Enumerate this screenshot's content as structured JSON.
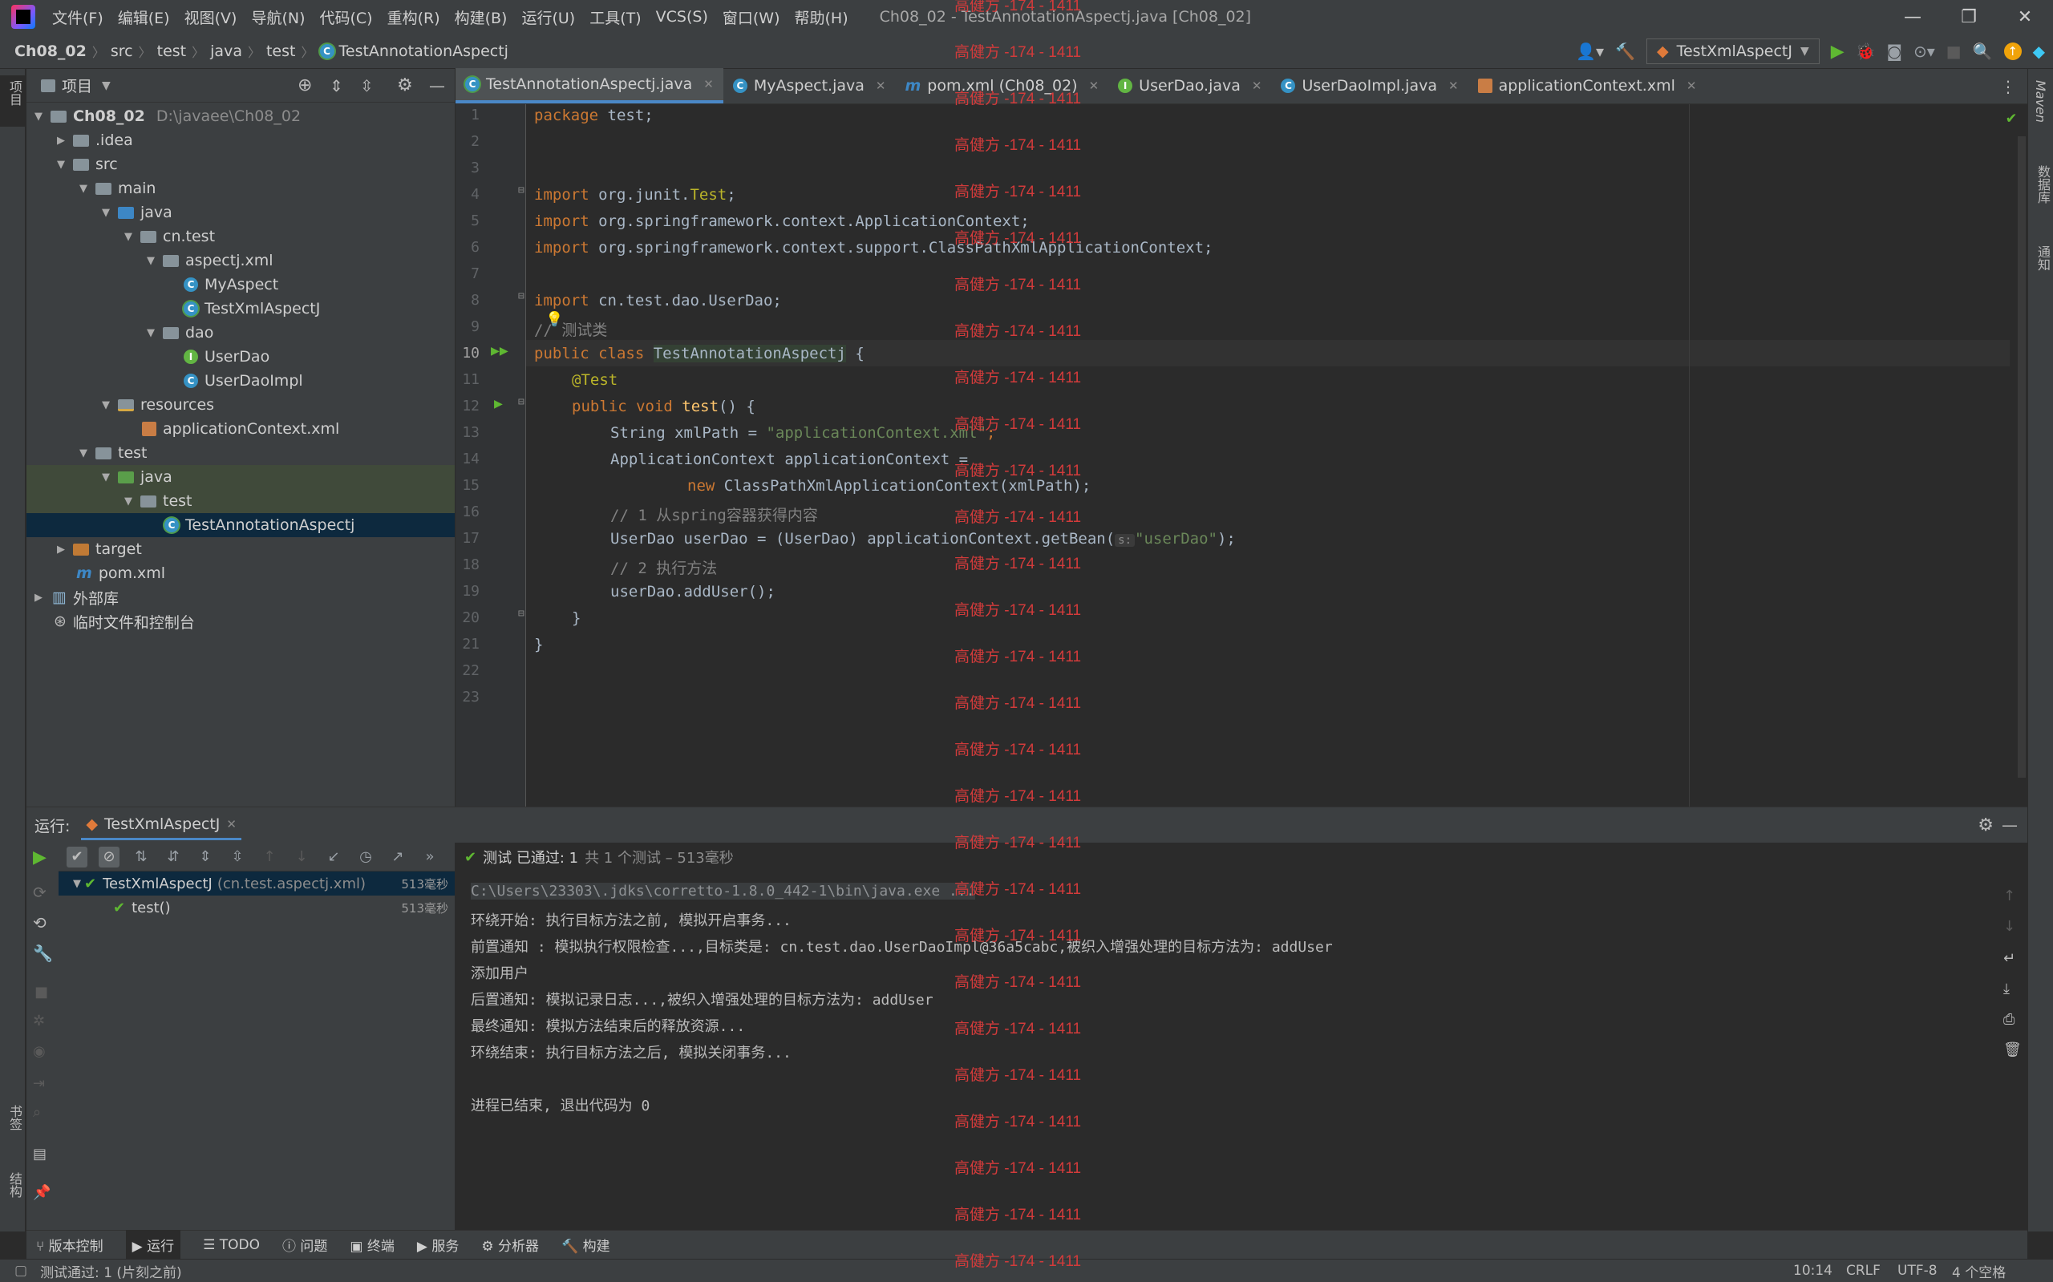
{
  "menu": {
    "items": [
      "文件(F)",
      "编辑(E)",
      "视图(V)",
      "导航(N)",
      "代码(C)",
      "重构(R)",
      "构建(B)",
      "运行(U)",
      "工具(T)",
      "VCS(S)",
      "窗口(W)",
      "帮助(H)"
    ],
    "window_title": "Ch08_02 - TestAnnotationAspectj.java [Ch08_02]"
  },
  "breadcrumb": {
    "items": [
      "Ch08_02",
      "src",
      "test",
      "java",
      "test",
      "TestAnnotationAspectj"
    ]
  },
  "toolbar": {
    "run_config": "TestXmlAspectJ"
  },
  "left_strip": {
    "project_label": "项目",
    "bookmarks_label": "书签",
    "structure_label": "结构"
  },
  "right_strip": {
    "maven_label": "Maven",
    "database_label": "数据库",
    "notifications_label": "通知"
  },
  "project": {
    "title": "项目",
    "root": {
      "name": "Ch08_02",
      "path": "D:\\javaee\\Ch08_02"
    },
    "tree": [
      ".idea",
      "src",
      "main",
      "java",
      "cn.test",
      "aspectj.xml",
      "MyAspect",
      "TestXmlAspectJ",
      "dao",
      "UserDao",
      "UserDaoImpl",
      "resources",
      "applicationContext.xml",
      "test",
      "java",
      "test",
      "TestAnnotationAspectj",
      "target",
      "pom.xml",
      "外部库",
      "临时文件和控制台"
    ]
  },
  "tabs": [
    "TestAnnotationAspectj.java",
    "MyAspect.java",
    "pom.xml (Ch08_02)",
    "UserDao.java",
    "UserDaoImpl.java",
    "applicationContext.xml"
  ],
  "code": {
    "line_numbers": [
      "1",
      "2",
      "3",
      "4",
      "5",
      "6",
      "7",
      "8",
      "9",
      "10",
      "11",
      "12",
      "13",
      "14",
      "15",
      "16",
      "17",
      "18",
      "19",
      "20",
      "21",
      "22",
      "23"
    ],
    "package_kw": "package",
    "package_name": " test;",
    "import_kw": "import",
    "import1": " org.junit.",
    "import1_cls": "Test",
    "import2": " org.springframework.context.ApplicationContext;",
    "import3": " org.springframework.context.support.ClassPathXmlApplicationContext;",
    "import4": " cn.test.dao.UserDao;",
    "comment_class": "// 测试类",
    "public_class": "public class ",
    "class_name": "TestAnnotationAspectj",
    " brace_open": " {",
    "annotation": "@Test",
    "public_void": "public void ",
    "method": "test",
    "method_sig": "() {",
    "string_decl": "String xmlPath = ",
    "string_val": "\"applicationContext.xml\"",
    "semi": ";",
    "ctx_decl": "ApplicationContext applicationContext =",
    "new_kw": "new ",
    "new_expr": "ClassPathXmlApplicationContext(xmlPath);",
    "comment1": "// 1 从spring容器获得内容",
    "userdao_decl": "UserDao userDao = (UserDao) applicationContext.getBean(",
    "hint": "s:",
    "userdao_str": "\"userDao\"",
    "userdao_end": ");",
    "comment2": "// 2 执行方法",
    "call": "userDao.addUser();",
    "close1": "}",
    "close2": "}"
  },
  "run": {
    "label": "运行:",
    "tab": "TestXmlAspectJ",
    "status": "测试 已通过: 1",
    "status_detail": "共 1 个测试 – 513毫秒",
    "tests": [
      {
        "name": "TestXmlAspectJ",
        "pkg": "(cn.test.aspectj.xml)",
        "time": "513毫秒"
      },
      {
        "name": "test()",
        "time": "513毫秒"
      }
    ],
    "console": [
      "C:\\Users\\23303\\.jdks\\corretto-1.8.0_442-1\\bin\\java.exe ...",
      "环绕开始: 执行目标方法之前, 模拟开启事务...",
      "前置通知 : 模拟执行权限检查...,目标类是: cn.test.dao.UserDaoImpl@36a5cabc,被织入增强处理的目标方法为: addUser",
      "添加用户",
      "后置通知: 模拟记录日志...,被织入增强处理的目标方法为: addUser",
      "最终通知: 模拟方法结束后的释放资源...",
      "环绕结束: 执行目标方法之后, 模拟关闭事务...",
      "",
      "进程已结束, 退出代码为 0"
    ]
  },
  "bottom_tools": [
    "版本控制",
    "运行",
    "TODO",
    "问题",
    "终端",
    "服务",
    "分析器",
    "构建"
  ],
  "statusbar": {
    "message": "测试通过: 1 (片刻之前)",
    "position": "10:14",
    "line_sep": "CRLF",
    "encoding": "UTF-8",
    "indent": "4 个空格"
  },
  "watermark": "高健方 -174 - 1411",
  "colors": {
    "accent": "#4a88c7",
    "pass": "#5fb832",
    "watermark": "#d23b3b"
  }
}
